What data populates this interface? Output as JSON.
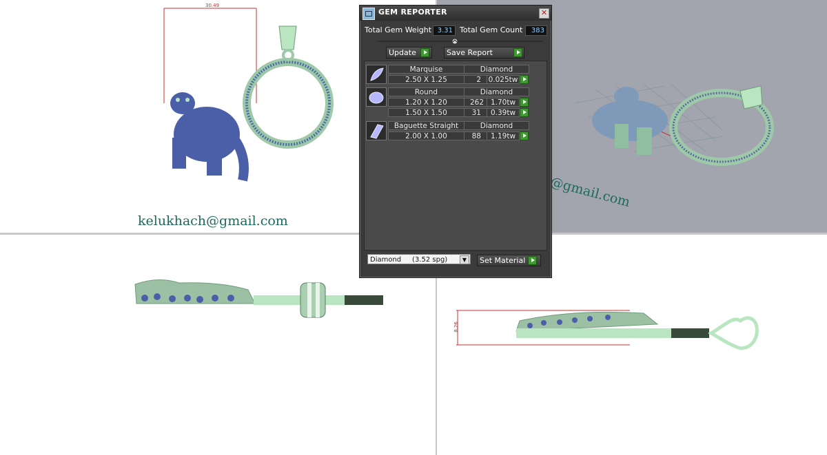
{
  "viewports": {
    "top_watermark": "kelukhach@gmail.com",
    "persp_watermark": "h@gmail.com",
    "top_dimension": "30.49",
    "right_dimension": "8.26"
  },
  "dialog": {
    "title": "GEM REPORTER",
    "total_weight_label": "Total Gem Weight",
    "total_weight_value": "3.31",
    "total_count_label": "Total Gem Count",
    "total_count_value": "383",
    "update_label": "Update",
    "save_report_label": "Save Report",
    "groups": [
      {
        "cut": "Marquise",
        "material": "Diamond",
        "rows": [
          {
            "size": "2.50 X 1.25",
            "count": "2",
            "weight": "0.025tw"
          }
        ]
      },
      {
        "cut": "Round",
        "material": "Diamond",
        "rows": [
          {
            "size": "1.20 X 1.20",
            "count": "262",
            "weight": "1.70tw"
          },
          {
            "size": "1.50 X 1.50",
            "count": "31",
            "weight": "0.39tw"
          }
        ]
      },
      {
        "cut": "Baguette Straight",
        "material": "Diamond",
        "rows": [
          {
            "size": "2.00 X 1.00",
            "count": "88",
            "weight": "1.19tw"
          }
        ]
      }
    ],
    "material_select": "Diamond     (3.52 spg)",
    "set_material_label": "Set Material"
  },
  "colors": {
    "metal": "#b9e6c0",
    "gem": "#4a5fa8",
    "accent_green": "#3e9a2e"
  }
}
